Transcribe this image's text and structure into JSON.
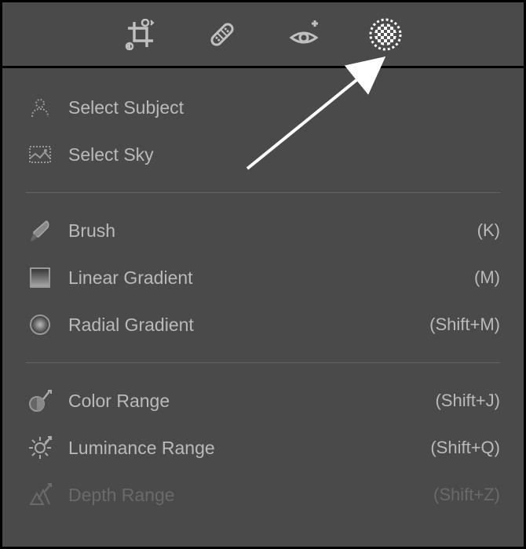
{
  "toolbar": {
    "tools": [
      {
        "name": "crop-tool"
      },
      {
        "name": "healing-tool"
      },
      {
        "name": "red-eye-tool"
      },
      {
        "name": "masking-tool"
      }
    ]
  },
  "menu": {
    "sections": [
      {
        "items": [
          {
            "label": "Select Subject",
            "shortcut": "",
            "icon": "person-icon"
          },
          {
            "label": "Select Sky",
            "shortcut": "",
            "icon": "sky-icon"
          }
        ]
      },
      {
        "items": [
          {
            "label": "Brush",
            "shortcut": "(K)",
            "icon": "brush-icon"
          },
          {
            "label": "Linear Gradient",
            "shortcut": "(M)",
            "icon": "linear-gradient-icon"
          },
          {
            "label": "Radial Gradient",
            "shortcut": "(Shift+M)",
            "icon": "radial-gradient-icon"
          }
        ]
      },
      {
        "items": [
          {
            "label": "Color Range",
            "shortcut": "(Shift+J)",
            "icon": "color-range-icon"
          },
          {
            "label": "Luminance Range",
            "shortcut": "(Shift+Q)",
            "icon": "luminance-range-icon"
          },
          {
            "label": "Depth Range",
            "shortcut": "(Shift+Z)",
            "icon": "depth-range-icon",
            "disabled": true
          }
        ]
      }
    ]
  }
}
